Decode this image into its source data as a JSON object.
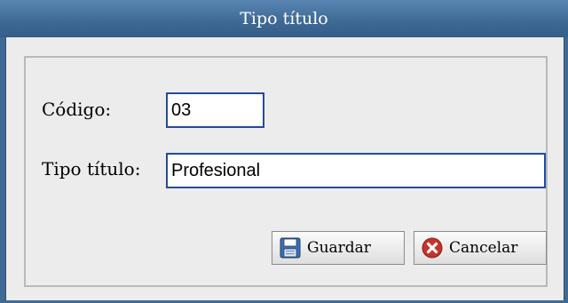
{
  "window": {
    "title": "Tipo título"
  },
  "form": {
    "codigo_label": "Código:",
    "codigo_value": "03",
    "tipo_label": "Tipo título:",
    "tipo_value": "Profesional"
  },
  "buttons": {
    "save_label": "Guardar",
    "save_icon": "floppy-disk-icon",
    "cancel_label": "Cancelar",
    "cancel_icon": "red-x-icon"
  },
  "colors": {
    "titlebar": "#3f6a96",
    "field_border": "#244a9e",
    "cancel_icon": "#c8322c"
  }
}
